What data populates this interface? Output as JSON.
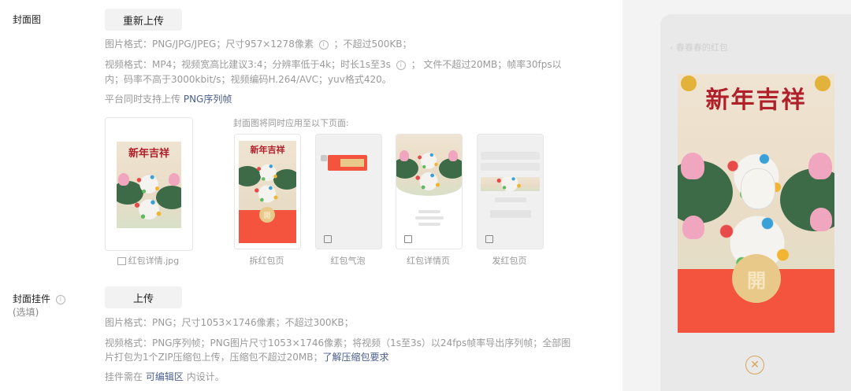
{
  "cover": {
    "label": "封面图",
    "reupload_button": "重新上传",
    "image_format_prefix": "图片格式：PNG/JPG/JPEG；尺寸957×1278像素",
    "image_format_suffix": "；不超过500KB；",
    "video_format_a": "视频格式：MP4；视频宽高比建议3:4；分辨率低于4k；时长1s至3s",
    "video_format_b": "； 文件不超过20MB；帧率30fps以",
    "video_format_c": "内；码率不高于3000kbit/s；视频编码H.264/AVC；yuv格式420。",
    "png_seq_prefix": "平台同时支持上传",
    "png_seq_link": "PNG序列帧",
    "applies_to": "封面图将同时应用至以下页面:",
    "file_name": "红包详情.jpg",
    "art_title": "新年吉祥",
    "pages": [
      "拆红包页",
      "红包气泡",
      "红包详情页",
      "发红包页"
    ],
    "open_char": "開"
  },
  "pendant": {
    "label": "封面挂件",
    "optional": "(选填)",
    "upload_button": "上传",
    "image_format": "图片格式：PNG；尺寸1053×1746像素；不超过300KB；",
    "video_format_a": "视频格式：PNG序列帧；PNG图片尺寸1053×1746像素；将视频（1s至3s）以24fps帧率导出序列帧；全部图",
    "video_format_b_prefix": "片打包为1个ZIP压缩包上传，压缩包不超过20MB；",
    "video_format_b_link": "了解压缩包要求",
    "edit_area_prefix": "挂件需在",
    "edit_area_link": "可编辑区",
    "edit_area_suffix": "内设计。"
  },
  "preview": {
    "top_text": "‹          春春春的红包",
    "close_icon": "close-circle-icon"
  }
}
